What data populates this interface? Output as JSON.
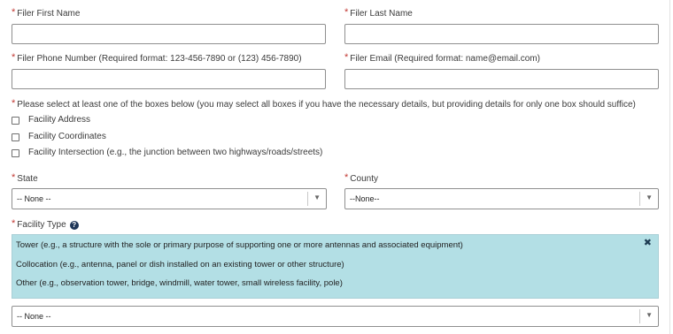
{
  "required_marker": "*",
  "filer_first_name": {
    "label": "Filer First Name",
    "value": ""
  },
  "filer_last_name": {
    "label": "Filer Last Name",
    "value": ""
  },
  "filer_phone": {
    "label": "Filer Phone Number (Required format: 123-456-7890 or (123) 456-7890)",
    "value": ""
  },
  "filer_email": {
    "label": "Filer Email (Required format: name@email.com)",
    "value": ""
  },
  "location_boxes": {
    "instruction": "Please select at least one of the boxes below (you may select all boxes if you have the necessary details, but providing details for only one box should suffice)",
    "options": [
      "Facility Address",
      "Facility Coordinates",
      "Facility Intersection (e.g., the junction between two highways/roads/streets)"
    ]
  },
  "state": {
    "label": "State",
    "selected": "-- None --"
  },
  "county": {
    "label": "County",
    "selected": "--None--"
  },
  "facility_type": {
    "label": "Facility Type",
    "help_icon": "question-circle-icon",
    "help_glyph": "?",
    "close_glyph": "✖",
    "options": [
      "Tower (e.g., a structure with the sole or primary purpose of supporting one or more antennas and associated equipment)",
      "Collocation (e.g., antenna, panel or dish installed on an existing tower or other structure)",
      "Other (e.g., observation tower, bridge, windmill, water tower, small wireless facility, pole)"
    ],
    "selected": "-- None --"
  },
  "dropdown_arrow": "▼",
  "colors": {
    "required": "#c23934",
    "options_panel": "#b3dfe5",
    "help_icon": "#1d3557"
  }
}
